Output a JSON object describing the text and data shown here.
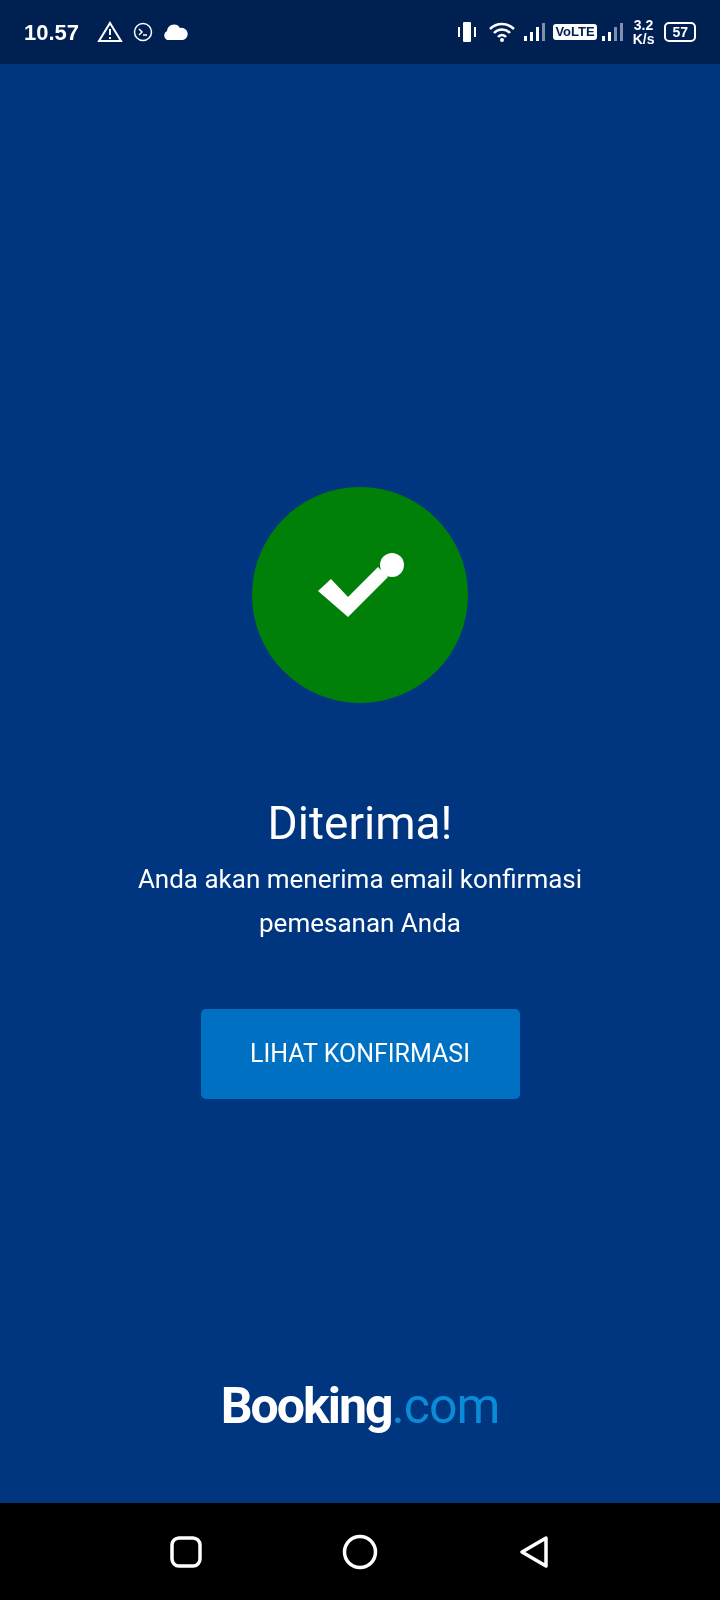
{
  "status_bar": {
    "time": "10.57",
    "volte": "VoLTE",
    "speed_value": "3.2",
    "speed_unit": "K/s",
    "battery": "57"
  },
  "confirmation": {
    "title": "Diterima!",
    "message": "Anda akan menerima email konfirmasi pemesanan Anda",
    "button": "LIHAT KONFIRMASI"
  },
  "logo": {
    "name": "Booking",
    "suffix": ".com"
  }
}
